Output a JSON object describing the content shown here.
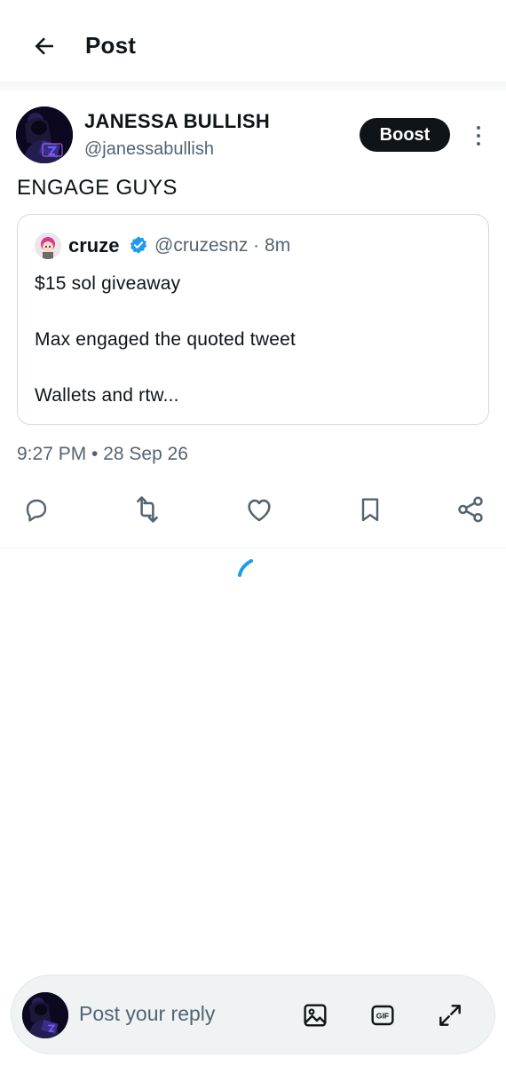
{
  "header": {
    "title": "Post"
  },
  "author": {
    "name": "JANESSA BULLISH",
    "handle": "@janessabullish",
    "boost_label": "Boost"
  },
  "post": {
    "text": "ENGAGE GUYS"
  },
  "quote": {
    "name": "cruze",
    "handle_time": "@cruzesnz · 8m",
    "lines": [
      "$15 sol giveaway",
      "Max engaged the quoted tweet",
      "Wallets and rtw..."
    ]
  },
  "timestamp": "9:27 PM • 28 Sep 26",
  "actions": [
    "reply-icon",
    "repost-icon",
    "like-icon",
    "bookmark-icon",
    "share-icon"
  ],
  "reply_bar": {
    "placeholder": "Post your reply"
  },
  "colors": {
    "accent": "#1d9bf0",
    "text": "#0f1419",
    "muted": "#536471",
    "border": "#cfd9de"
  }
}
